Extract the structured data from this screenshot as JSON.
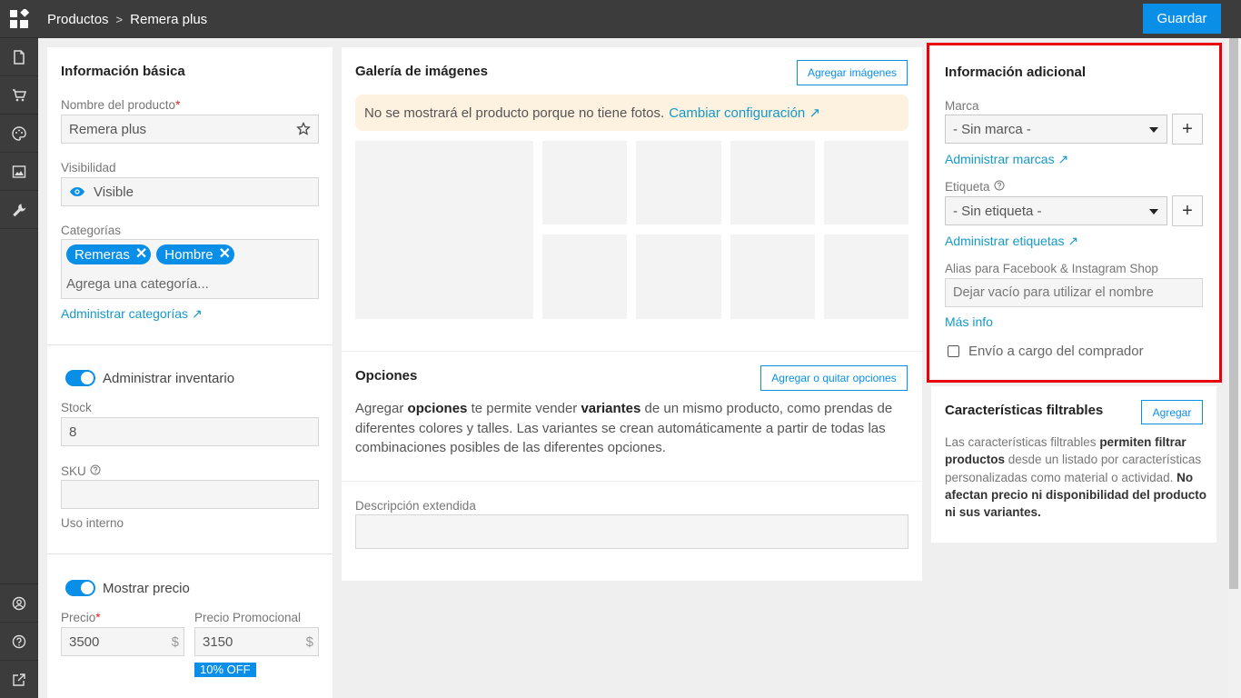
{
  "topbar": {
    "breadcrumb_root": "Productos",
    "breadcrumb_sep": ">",
    "breadcrumb_current": "Remera plus",
    "save_label": "Guardar"
  },
  "rail": {
    "items": [
      "document-icon",
      "cart-icon",
      "palette-icon",
      "image-icon",
      "wrench-icon"
    ],
    "bottom_items": [
      "account-icon",
      "help-icon",
      "external-link-icon"
    ]
  },
  "basic": {
    "title": "Información básica",
    "name_label": "Nombre del producto",
    "required_mark": "*",
    "name_value": "Remera plus",
    "visibility_label": "Visibilidad",
    "visibility_value": "Visible",
    "categories_label": "Categorías",
    "categories": [
      "Remeras",
      "Hombre"
    ],
    "category_remove": "✕",
    "category_placeholder": "Agrega una categoría...",
    "manage_categories": "Administrar categorías ↗"
  },
  "inventory": {
    "toggle_label": "Administrar inventario",
    "stock_label": "Stock",
    "stock_value": "8",
    "sku_label": "SKU",
    "sku_value": "",
    "sku_help": "Uso interno"
  },
  "price": {
    "toggle_label": "Mostrar precio",
    "price_label": "Precio",
    "price_value": "3500",
    "promo_label": "Precio Promocional",
    "promo_value": "3150",
    "currency": "$",
    "discount_badge": "10% OFF"
  },
  "gallery": {
    "title": "Galería de imágenes",
    "add_button": "Agregar imágenes",
    "warning_text": "No se mostrará el producto porque no tiene fotos.",
    "warning_link": "Cambiar configuración ↗"
  },
  "options": {
    "title": "Opciones",
    "button": "Agregar o quitar opciones",
    "text_1": "Agregar ",
    "bold_1": "opciones",
    "text_2": " te permite vender ",
    "bold_2": "variantes",
    "text_3": " de un mismo producto, como prendas de diferentes colores y talles. Las variantes se crean automáticamente a partir de todas las combinaciones posibles de las diferentes opciones."
  },
  "description": {
    "label": "Descripción extendida",
    "value": ""
  },
  "additional": {
    "title": "Información adicional",
    "brand_label": "Marca",
    "brand_value": "- Sin marca -",
    "manage_brands": "Administrar marcas ↗",
    "tag_label": "Etiqueta",
    "tag_value": "- Sin etiqueta -",
    "manage_tags": "Administrar etiquetas ↗",
    "alias_label": "Alias para Facebook & Instagram Shop",
    "alias_placeholder": "Dejar vacío para utilizar el nombre",
    "more_info": "Más info",
    "shipping_label": "Envío a cargo del comprador",
    "plus": "+",
    "highlight_color": "#e8000b"
  },
  "filters": {
    "title": "Características filtrables",
    "add_button": "Agregar",
    "t1": "Las características filtrables ",
    "b1": "permiten filtrar productos",
    "t2": " desde un listado por características personalizadas como material o actividad. ",
    "b2": "No afectan precio ni disponibilidad del producto ni sus variantes."
  }
}
